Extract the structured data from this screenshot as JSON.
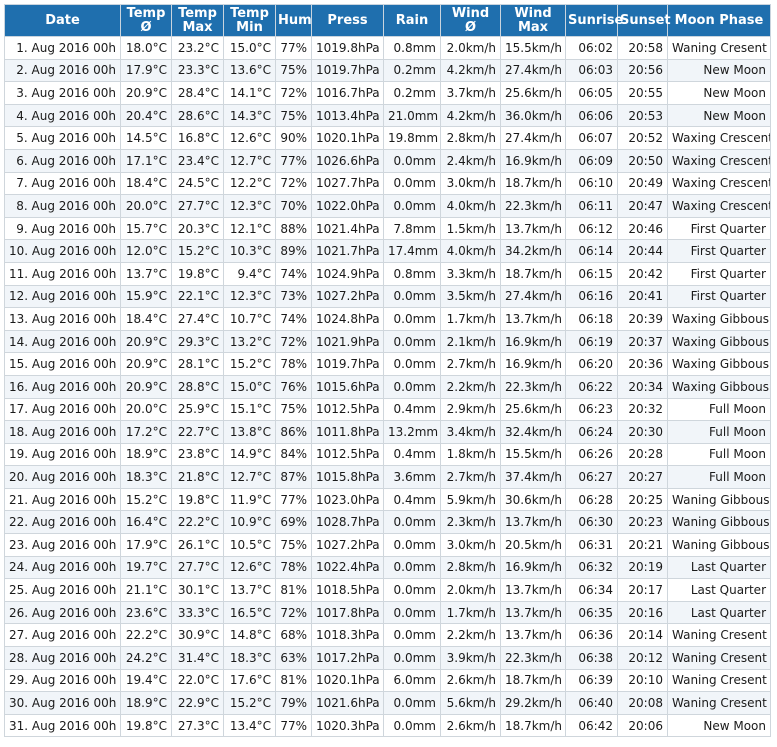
{
  "headers": {
    "date": "Date",
    "temp_avg": [
      "Temp",
      "Ø"
    ],
    "temp_max": [
      "Temp",
      "Max"
    ],
    "temp_min": [
      "Temp",
      "Min"
    ],
    "hum": "Hum",
    "press": "Press",
    "rain": "Rain",
    "wind_avg": [
      "Wind",
      "Ø"
    ],
    "wind_max": [
      "Wind",
      "Max"
    ],
    "sunrise": "Sunrise",
    "sunset": "Sunset",
    "moon": "Moon Phase"
  },
  "rows": [
    [
      "1. Aug 2016 00h",
      "18.0°C",
      "23.2°C",
      "15.0°C",
      "77%",
      "1019.8hPa",
      "0.8mm",
      "2.0km/h",
      "15.5km/h",
      "06:02",
      "20:58",
      "Waning Cresent"
    ],
    [
      "2. Aug 2016 00h",
      "17.9°C",
      "23.3°C",
      "13.6°C",
      "75%",
      "1019.7hPa",
      "0.2mm",
      "4.2km/h",
      "27.4km/h",
      "06:03",
      "20:56",
      "New Moon"
    ],
    [
      "3. Aug 2016 00h",
      "20.9°C",
      "28.4°C",
      "14.1°C",
      "72%",
      "1016.7hPa",
      "0.2mm",
      "3.7km/h",
      "25.6km/h",
      "06:05",
      "20:55",
      "New Moon"
    ],
    [
      "4. Aug 2016 00h",
      "20.4°C",
      "28.6°C",
      "14.3°C",
      "75%",
      "1013.4hPa",
      "21.0mm",
      "4.2km/h",
      "36.0km/h",
      "06:06",
      "20:53",
      "New Moon"
    ],
    [
      "5. Aug 2016 00h",
      "14.5°C",
      "16.8°C",
      "12.6°C",
      "90%",
      "1020.1hPa",
      "19.8mm",
      "2.8km/h",
      "27.4km/h",
      "06:07",
      "20:52",
      "Waxing Crescent"
    ],
    [
      "6. Aug 2016 00h",
      "17.1°C",
      "23.4°C",
      "12.7°C",
      "77%",
      "1026.6hPa",
      "0.0mm",
      "2.4km/h",
      "16.9km/h",
      "06:09",
      "20:50",
      "Waxing Crescent"
    ],
    [
      "7. Aug 2016 00h",
      "18.4°C",
      "24.5°C",
      "12.2°C",
      "72%",
      "1027.7hPa",
      "0.0mm",
      "3.0km/h",
      "18.7km/h",
      "06:10",
      "20:49",
      "Waxing Crescent"
    ],
    [
      "8. Aug 2016 00h",
      "20.0°C",
      "27.7°C",
      "12.3°C",
      "70%",
      "1022.0hPa",
      "0.0mm",
      "4.0km/h",
      "22.3km/h",
      "06:11",
      "20:47",
      "Waxing Crescent"
    ],
    [
      "9. Aug 2016 00h",
      "15.7°C",
      "20.3°C",
      "12.1°C",
      "88%",
      "1021.4hPa",
      "7.8mm",
      "1.5km/h",
      "13.7km/h",
      "06:12",
      "20:46",
      "First Quarter"
    ],
    [
      "10. Aug 2016 00h",
      "12.0°C",
      "15.2°C",
      "10.3°C",
      "89%",
      "1021.7hPa",
      "17.4mm",
      "4.0km/h",
      "34.2km/h",
      "06:14",
      "20:44",
      "First Quarter"
    ],
    [
      "11. Aug 2016 00h",
      "13.7°C",
      "19.8°C",
      "9.4°C",
      "74%",
      "1024.9hPa",
      "0.8mm",
      "3.3km/h",
      "18.7km/h",
      "06:15",
      "20:42",
      "First Quarter"
    ],
    [
      "12. Aug 2016 00h",
      "15.9°C",
      "22.1°C",
      "12.3°C",
      "73%",
      "1027.2hPa",
      "0.0mm",
      "3.5km/h",
      "27.4km/h",
      "06:16",
      "20:41",
      "First Quarter"
    ],
    [
      "13. Aug 2016 00h",
      "18.4°C",
      "27.4°C",
      "10.7°C",
      "74%",
      "1024.8hPa",
      "0.0mm",
      "1.7km/h",
      "13.7km/h",
      "06:18",
      "20:39",
      "Waxing Gibbous"
    ],
    [
      "14. Aug 2016 00h",
      "20.9°C",
      "29.3°C",
      "13.2°C",
      "72%",
      "1021.9hPa",
      "0.0mm",
      "2.1km/h",
      "16.9km/h",
      "06:19",
      "20:37",
      "Waxing Gibbous"
    ],
    [
      "15. Aug 2016 00h",
      "20.9°C",
      "28.1°C",
      "15.2°C",
      "78%",
      "1019.7hPa",
      "0.0mm",
      "2.7km/h",
      "16.9km/h",
      "06:20",
      "20:36",
      "Waxing Gibbous"
    ],
    [
      "16. Aug 2016 00h",
      "20.9°C",
      "28.8°C",
      "15.0°C",
      "76%",
      "1015.6hPa",
      "0.0mm",
      "2.2km/h",
      "22.3km/h",
      "06:22",
      "20:34",
      "Waxing Gibbous"
    ],
    [
      "17. Aug 2016 00h",
      "20.0°C",
      "25.9°C",
      "15.1°C",
      "75%",
      "1012.5hPa",
      "0.4mm",
      "2.9km/h",
      "25.6km/h",
      "06:23",
      "20:32",
      "Full Moon"
    ],
    [
      "18. Aug 2016 00h",
      "17.2°C",
      "22.7°C",
      "13.8°C",
      "86%",
      "1011.8hPa",
      "13.2mm",
      "3.4km/h",
      "32.4km/h",
      "06:24",
      "20:30",
      "Full Moon"
    ],
    [
      "19. Aug 2016 00h",
      "18.9°C",
      "23.8°C",
      "14.9°C",
      "84%",
      "1012.5hPa",
      "0.4mm",
      "1.8km/h",
      "15.5km/h",
      "06:26",
      "20:28",
      "Full Moon"
    ],
    [
      "20. Aug 2016 00h",
      "18.3°C",
      "21.8°C",
      "12.7°C",
      "87%",
      "1015.8hPa",
      "3.6mm",
      "2.7km/h",
      "37.4km/h",
      "06:27",
      "20:27",
      "Full Moon"
    ],
    [
      "21. Aug 2016 00h",
      "15.2°C",
      "19.8°C",
      "11.9°C",
      "77%",
      "1023.0hPa",
      "0.4mm",
      "5.9km/h",
      "30.6km/h",
      "06:28",
      "20:25",
      "Waning Gibbous"
    ],
    [
      "22. Aug 2016 00h",
      "16.4°C",
      "22.2°C",
      "10.9°C",
      "69%",
      "1028.7hPa",
      "0.0mm",
      "2.3km/h",
      "13.7km/h",
      "06:30",
      "20:23",
      "Waning Gibbous"
    ],
    [
      "23. Aug 2016 00h",
      "17.9°C",
      "26.1°C",
      "10.5°C",
      "75%",
      "1027.2hPa",
      "0.0mm",
      "3.0km/h",
      "20.5km/h",
      "06:31",
      "20:21",
      "Waning Gibbous"
    ],
    [
      "24. Aug 2016 00h",
      "19.7°C",
      "27.7°C",
      "12.6°C",
      "78%",
      "1022.4hPa",
      "0.0mm",
      "2.8km/h",
      "16.9km/h",
      "06:32",
      "20:19",
      "Last Quarter"
    ],
    [
      "25. Aug 2016 00h",
      "21.1°C",
      "30.1°C",
      "13.7°C",
      "81%",
      "1018.5hPa",
      "0.0mm",
      "2.0km/h",
      "13.7km/h",
      "06:34",
      "20:17",
      "Last Quarter"
    ],
    [
      "26. Aug 2016 00h",
      "23.6°C",
      "33.3°C",
      "16.5°C",
      "72%",
      "1017.8hPa",
      "0.0mm",
      "1.7km/h",
      "13.7km/h",
      "06:35",
      "20:16",
      "Last Quarter"
    ],
    [
      "27. Aug 2016 00h",
      "22.2°C",
      "30.9°C",
      "14.8°C",
      "68%",
      "1018.3hPa",
      "0.0mm",
      "2.2km/h",
      "13.7km/h",
      "06:36",
      "20:14",
      "Waning Cresent"
    ],
    [
      "28. Aug 2016 00h",
      "24.2°C",
      "31.4°C",
      "18.3°C",
      "63%",
      "1017.2hPa",
      "0.0mm",
      "3.9km/h",
      "22.3km/h",
      "06:38",
      "20:12",
      "Waning Cresent"
    ],
    [
      "29. Aug 2016 00h",
      "19.4°C",
      "22.0°C",
      "17.6°C",
      "81%",
      "1020.1hPa",
      "6.0mm",
      "2.6km/h",
      "18.7km/h",
      "06:39",
      "20:10",
      "Waning Cresent"
    ],
    [
      "30. Aug 2016 00h",
      "18.9°C",
      "22.9°C",
      "15.2°C",
      "79%",
      "1021.6hPa",
      "0.0mm",
      "5.6km/h",
      "29.2km/h",
      "06:40",
      "20:08",
      "Waning Cresent"
    ],
    [
      "31. Aug 2016 00h",
      "19.8°C",
      "27.3°C",
      "13.4°C",
      "77%",
      "1020.3hPa",
      "0.0mm",
      "2.6km/h",
      "18.7km/h",
      "06:42",
      "20:06",
      "New Moon"
    ]
  ],
  "colors": {
    "header_bg": "#1f6fae",
    "header_text": "#ffffff",
    "row_alt": "#f1f5f9",
    "border": "#cfd6dc"
  }
}
